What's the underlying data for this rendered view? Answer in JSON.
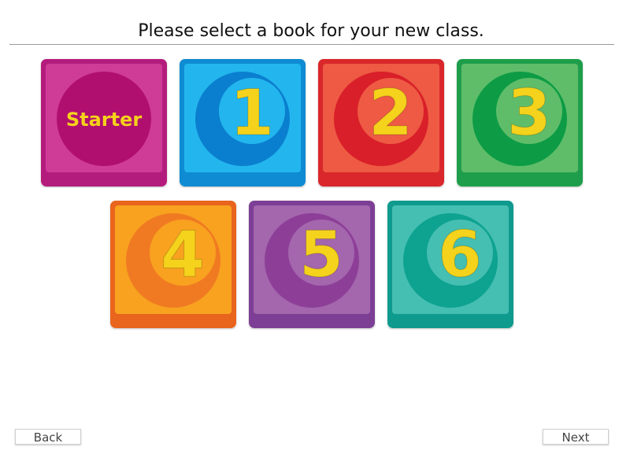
{
  "header": {
    "title": "Please select a book for your new class."
  },
  "books": [
    {
      "label": "Starter",
      "outer": "#b31c7c",
      "inner": "#cf3c98",
      "circle": "#b10f70",
      "ring": "#b10f70",
      "text_color": "#f5d21b"
    },
    {
      "label": "1",
      "outer": "#0e8bd3",
      "inner": "#23b6ee",
      "circle": "#0b7fcf",
      "ring": "#23b6ee",
      "text_color": "#f5d21b"
    },
    {
      "label": "2",
      "outer": "#d9272b",
      "inner": "#ee5a43",
      "circle": "#d91f2a",
      "ring": "#ee5a43",
      "text_color": "#f5d21b"
    },
    {
      "label": "3",
      "outer": "#1e9e4b",
      "inner": "#5fbd6a",
      "circle": "#0d9c45",
      "ring": "#5fbd6a",
      "text_color": "#f5d21b"
    },
    {
      "label": "4",
      "outer": "#e9641d",
      "inner": "#f8a220",
      "circle": "#f07a22",
      "ring": "#f8a220",
      "text_color": "#f5d21b"
    },
    {
      "label": "5",
      "outer": "#7d3f95",
      "inner": "#a466ad",
      "circle": "#8d3f98",
      "ring": "#a466ad",
      "text_color": "#f5d21b"
    },
    {
      "label": "6",
      "outer": "#0f9a8e",
      "inner": "#45bfb1",
      "circle": "#0ea291",
      "ring": "#45bfb1",
      "text_color": "#f5d21b"
    }
  ],
  "footer": {
    "back_label": "Back",
    "next_label": "Next"
  }
}
